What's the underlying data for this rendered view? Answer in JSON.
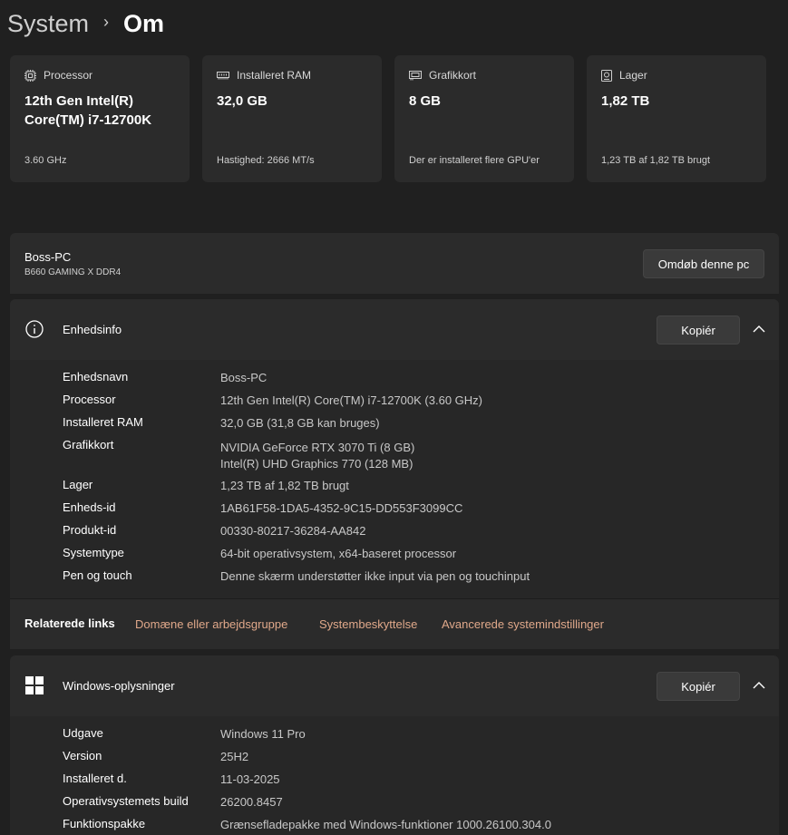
{
  "breadcrumb": {
    "parent": "System",
    "separator": "›",
    "current": "Om"
  },
  "cards": [
    {
      "icon": "processor-icon",
      "title": "Processor",
      "value": "12th Gen Intel(R) Core(TM) i7-12700K",
      "detail": "3.60 GHz"
    },
    {
      "icon": "ram-icon",
      "title": "Installeret RAM",
      "value": "32,0 GB",
      "detail": "Hastighed: 2666 MT/s"
    },
    {
      "icon": "gpu-icon",
      "title": "Grafikkort",
      "value": "8 GB",
      "detail": "Der er installeret flere GPU'er"
    },
    {
      "icon": "storage-icon",
      "title": "Lager",
      "value": "1,82 TB",
      "detail": "1,23 TB af 1,82 TB brugt"
    }
  ],
  "pc": {
    "name": "Boss-PC",
    "model": "B660 GAMING X DDR4",
    "rename_label": "Omdøb denne pc"
  },
  "device_info": {
    "icon": "info-icon",
    "title": "Enhedsinfo",
    "copy_label": "Kopiér",
    "rows": [
      {
        "key": "Enhedsnavn",
        "value": "Boss-PC"
      },
      {
        "key": "Processor",
        "value": "12th Gen Intel(R) Core(TM) i7-12700K (3.60 GHz)"
      },
      {
        "key": "Installeret RAM",
        "value": "32,0 GB (31,8 GB kan bruges)"
      },
      {
        "key": "Grafikkort",
        "value": "NVIDIA GeForce RTX 3070 Ti (8 GB)",
        "value2": "Intel(R) UHD Graphics 770 (128 MB)"
      },
      {
        "key": "Lager",
        "value": "1,23 TB af 1,82 TB brugt"
      },
      {
        "key": "Enheds-id",
        "value": "1AB61F58-1DA5-4352-9C15-DD553F3099CC"
      },
      {
        "key": "Produkt-id",
        "value": "00330-80217-36284-AA842"
      },
      {
        "key": "Systemtype",
        "value": "64-bit operativsystem, x64-baseret processor"
      },
      {
        "key": "Pen og touch",
        "value": "Denne skærm understøtter ikke input via pen og touchinput"
      }
    ]
  },
  "related": {
    "label": "Relaterede links",
    "links": [
      "Domæne eller arbejdsgruppe",
      "Systembeskyttelse",
      "Avancerede systemindstillinger"
    ]
  },
  "windows_info": {
    "icon": "windows-logo-icon",
    "title": "Windows-oplysninger",
    "copy_label": "Kopiér",
    "rows": [
      {
        "key": "Udgave",
        "value": "Windows 11 Pro"
      },
      {
        "key": "Version",
        "value": "25H2"
      },
      {
        "key": "Installeret d.",
        "value": "11-03-2025"
      },
      {
        "key": "Operativsystemets build",
        "value": "26200.8457"
      },
      {
        "key": "Funktionspakke",
        "value": "Grænsefladepakke med Windows-funktioner 1000.26100.304.0"
      }
    ]
  },
  "colors": {
    "background": "#202020",
    "card": "#2b2b2b",
    "link": "#e0a88a"
  }
}
